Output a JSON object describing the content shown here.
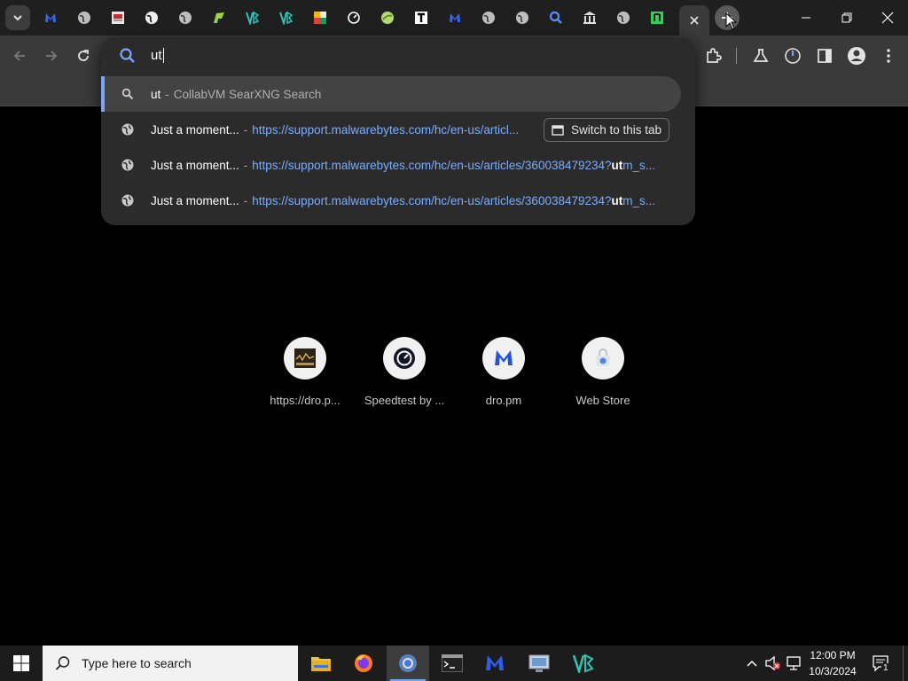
{
  "tabs": {
    "favicons": [
      "malwarebytes-icon",
      "globe-icon",
      "page-icon",
      "globe-icon",
      "globe-icon",
      "green-app-icon",
      "vb-icon",
      "vb-icon",
      "colorful-app-icon",
      "speedtest-icon",
      "green-ball-icon",
      "t-icon",
      "malwarebytes-icon",
      "globe-icon",
      "globe-icon",
      "search-icon",
      "bank-icon",
      "globe-icon",
      "green-t-icon"
    ]
  },
  "omnibox": {
    "input_value": "ut",
    "suggestions": [
      {
        "icon": "search-icon",
        "title": "ut",
        "sep": "-",
        "rest": "CollabVM SearXNG Search"
      },
      {
        "icon": "globe-icon",
        "title": "Just a moment...",
        "sep": "-",
        "url": "https://support.malwarebytes.com/hc/en-us/articl...",
        "button": "Switch to this tab"
      },
      {
        "icon": "globe-icon",
        "title": "Just a moment...",
        "sep": "-",
        "url_pre": "https://support.malwarebytes.com/hc/en-us/articles/360038479234?",
        "url_bold": "ut",
        "url_post": "m_s..."
      },
      {
        "icon": "globe-icon",
        "title": "Just a moment...",
        "sep": "-",
        "url_pre": "https://support.malwarebytes.com/hc/en-us/articles/360038479234?",
        "url_bold": "ut",
        "url_post": "m_s..."
      }
    ]
  },
  "shortcuts": [
    {
      "label": "https://dro.p...",
      "icon": "dro-thumbnail-icon"
    },
    {
      "label": "Speedtest by ...",
      "icon": "speedtest-icon"
    },
    {
      "label": "dro.pm",
      "icon": "malwarebytes-icon"
    },
    {
      "label": "Web Store",
      "icon": "webstore-icon"
    }
  ],
  "taskbar": {
    "search_placeholder": "Type here to search",
    "time": "12:00 PM",
    "date": "10/3/2024",
    "notification_count": "1"
  },
  "colors": {
    "accent": "#7ca4f8",
    "link": "#7cacf8",
    "toolbar": "#3a3a3a",
    "tabstrip": "#1f1f1f"
  }
}
